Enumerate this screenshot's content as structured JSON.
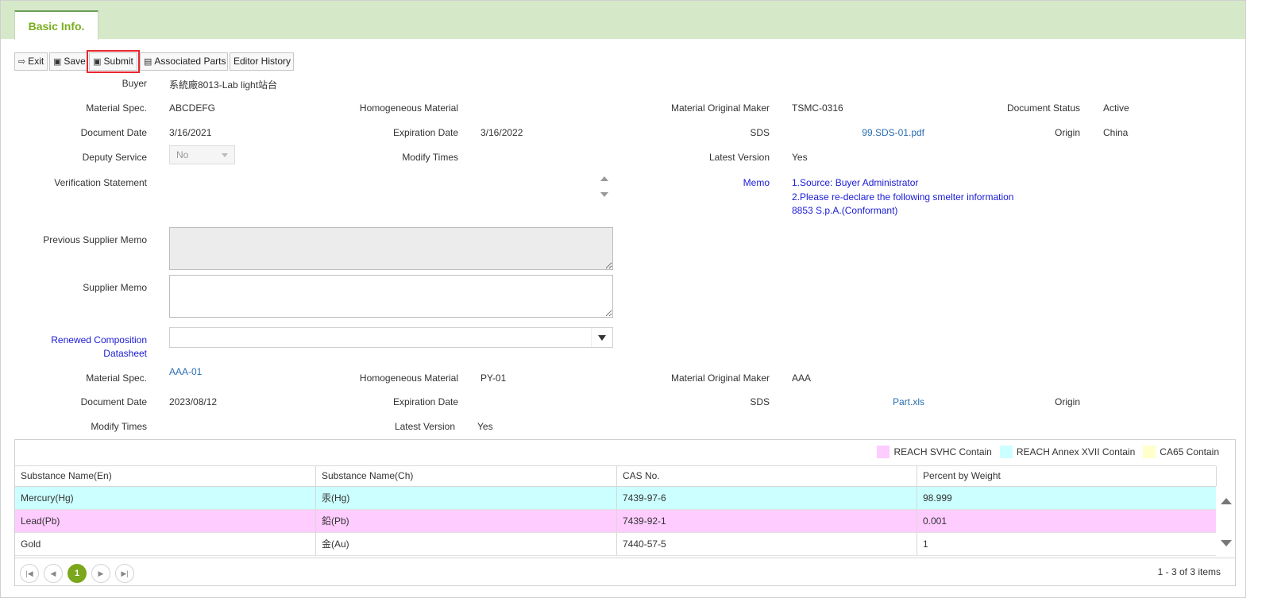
{
  "tabs": [
    {
      "label": "Basic Info."
    }
  ],
  "toolbar": {
    "exit": "Exit",
    "save": "Save",
    "submit": "Submit",
    "associated_parts": "Associated Parts",
    "editor_history": "Editor History"
  },
  "form": {
    "buyer": {
      "label": "Buyer",
      "value": "系統廠8013-Lab light站台"
    },
    "material_spec": {
      "label": "Material Spec.",
      "value": "ABCDEFG"
    },
    "homogeneous_material": {
      "label": "Homogeneous Material",
      "value": ""
    },
    "material_original_maker": {
      "label": "Material Original Maker",
      "value": "TSMC-0316"
    },
    "document_status": {
      "label": "Document Status",
      "value": "Active"
    },
    "document_date": {
      "label": "Document Date",
      "value": "3/16/2021"
    },
    "expiration_date": {
      "label": "Expiration Date",
      "value": "3/16/2022"
    },
    "sds": {
      "label": "SDS",
      "value": "99.SDS-01.pdf"
    },
    "origin": {
      "label": "Origin",
      "value": "China"
    },
    "deputy_service": {
      "label": "Deputy Service",
      "value": "No"
    },
    "modify_times": {
      "label": "Modify Times",
      "value": ""
    },
    "latest_version": {
      "label": "Latest Version",
      "value": "Yes"
    },
    "verification_statement": {
      "label": "Verification Statement",
      "value": ""
    },
    "memo": {
      "label": "Memo",
      "lines": [
        "1.Source: Buyer Administrator",
        "2.Please re-declare the following smelter information",
        "8853 S.p.A.(Conformant)"
      ]
    },
    "previous_supplier_memo": {
      "label": "Previous Supplier Memo",
      "value": ""
    },
    "supplier_memo": {
      "label": "Supplier Memo",
      "value": ""
    },
    "renewed_composition": {
      "label_line1": "Renewed Composition",
      "label_line2": "Datasheet",
      "value": ""
    }
  },
  "renewed": {
    "material_spec": {
      "label": "Material Spec.",
      "value": "AAA-01"
    },
    "homogeneous_material": {
      "label": "Homogeneous Material",
      "value": "PY-01"
    },
    "material_original_maker": {
      "label": "Material Original Maker",
      "value": "AAA"
    },
    "document_date": {
      "label": "Document Date",
      "value": "2023/08/12"
    },
    "expiration_date": {
      "label": "Expiration Date",
      "value": ""
    },
    "sds": {
      "label": "SDS",
      "value": "Part.xls"
    },
    "origin": {
      "label": "Origin",
      "value": ""
    },
    "modify_times": {
      "label": "Modify Times",
      "value": ""
    },
    "latest_version": {
      "label": "Latest Version",
      "value": "Yes"
    }
  },
  "legend": [
    {
      "label": "REACH SVHC Contain",
      "color": "#ffccff"
    },
    {
      "label": "REACH Annex XVII Contain",
      "color": "#ccffff"
    },
    {
      "label": "CA65 Contain",
      "color": "#ffffcc"
    }
  ],
  "table": {
    "columns": [
      "Substance Name(En)",
      "Substance Name(Ch)",
      "CAS No.",
      "Percent by Weight"
    ],
    "rows": [
      {
        "en": "Mercury(Hg)",
        "ch": "汞(Hg)",
        "cas": "7439-97-6",
        "pct": "98.999",
        "color": "#ccffff"
      },
      {
        "en": "Lead(Pb)",
        "ch": "鉛(Pb)",
        "cas": "7439-92-1",
        "pct": "0.001",
        "color": "#ffccff"
      },
      {
        "en": "Gold",
        "ch": "金(Au)",
        "cas": "7440-57-5",
        "pct": "1",
        "color": "#ffffff"
      }
    ]
  },
  "pager": {
    "current_page": "1",
    "info": "1 - 3 of 3 items"
  }
}
